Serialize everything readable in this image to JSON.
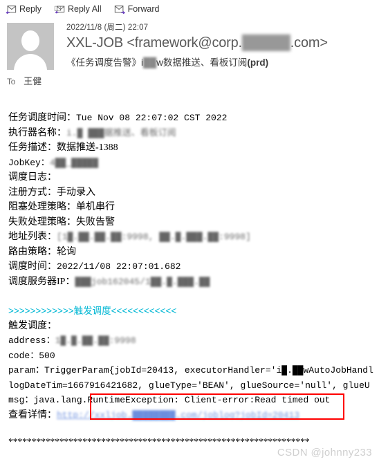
{
  "toolbar": {
    "items": [
      {
        "label": "Reply",
        "icon": "reply-icon"
      },
      {
        "label": "Reply All",
        "icon": "reply-all-icon"
      },
      {
        "label": "Forward",
        "icon": "forward-icon"
      }
    ]
  },
  "header": {
    "avatar_icon": "person-placeholder-icon",
    "date": "2022/11/8 (周二) 22:07",
    "from_prefix": "XXL-JOB <framework@corp.",
    "from_redacted": "█████",
    "from_suffix": ".com>",
    "subject_prefix": "《任务调度告警》i",
    "subject_redacted": "██",
    "subject_mid": "w数据推送、看板订阅",
    "subject_bold": "(prd)",
    "to_label": "To",
    "to_name": "王健"
  },
  "body": {
    "lines": [
      {
        "label": "任务调度时间：",
        "value": "Tue Nov 08 22:07:02 CST 2022",
        "style": "mono-value"
      },
      {
        "label": "执行器名称：",
        "value": "i.█ ███据推送、看板订阅",
        "style": "redacted-mid"
      },
      {
        "label": "任务描述：",
        "value": "数据推送-1388",
        "style": "plain"
      },
      {
        "label": "JobKey：",
        "value": "4██_█████",
        "style": "redacted"
      },
      {
        "label": "调度日志：",
        "value": "",
        "style": "plain"
      },
      {
        "label": "注册方式：",
        "value": "手动录入",
        "style": "plain"
      },
      {
        "label": "阻塞处理策略：",
        "value": "单机串行",
        "style": "plain"
      },
      {
        "label": "失败处理策略：",
        "value": "失败告警",
        "style": "plain"
      },
      {
        "label": "地址列表：",
        "value": "[1█.██.██.██:9998, ██.█.███.██:9998]",
        "style": "redacted"
      },
      {
        "label": "路由策略：",
        "value": "轮询",
        "style": "plain"
      },
      {
        "label": "调度时间：",
        "value": "2022/11/08 22:07:01.682",
        "style": "mono-value"
      },
      {
        "label": "调度服务器IP：",
        "value": "███job162045/1██.█.███.██",
        "style": "redacted"
      }
    ],
    "trigger_banner": ">>>>>>>>>>>>触发调度<<<<<<<<<<<<",
    "trigger_label": "触发调度：",
    "address_label": "address：",
    "address_value": "1█.█.██.██:9998",
    "code_label": "code：",
    "code_value": "500",
    "param_line1": "param：TriggerParam{jobId=20413, executorHandler='i█.██wAutoJobHandl",
    "param_line2": "logDateTim=1667916421682, glueType='BEAN', glueSource='null', glueU",
    "msg_line": "msg：java.lang.RuntimeException: Client-error:Read timed out",
    "detail_label": "查看详情：",
    "detail_link": "http://xxljob.████████.com/joblog?jobId=20413",
    "separator": "*****************************************************************"
  },
  "annotation": {
    "red_box_color": "#ff0000",
    "highlighted_text": "RuntimeException: Client-error:Read timed out"
  },
  "watermark": "CSDN @johnny233"
}
